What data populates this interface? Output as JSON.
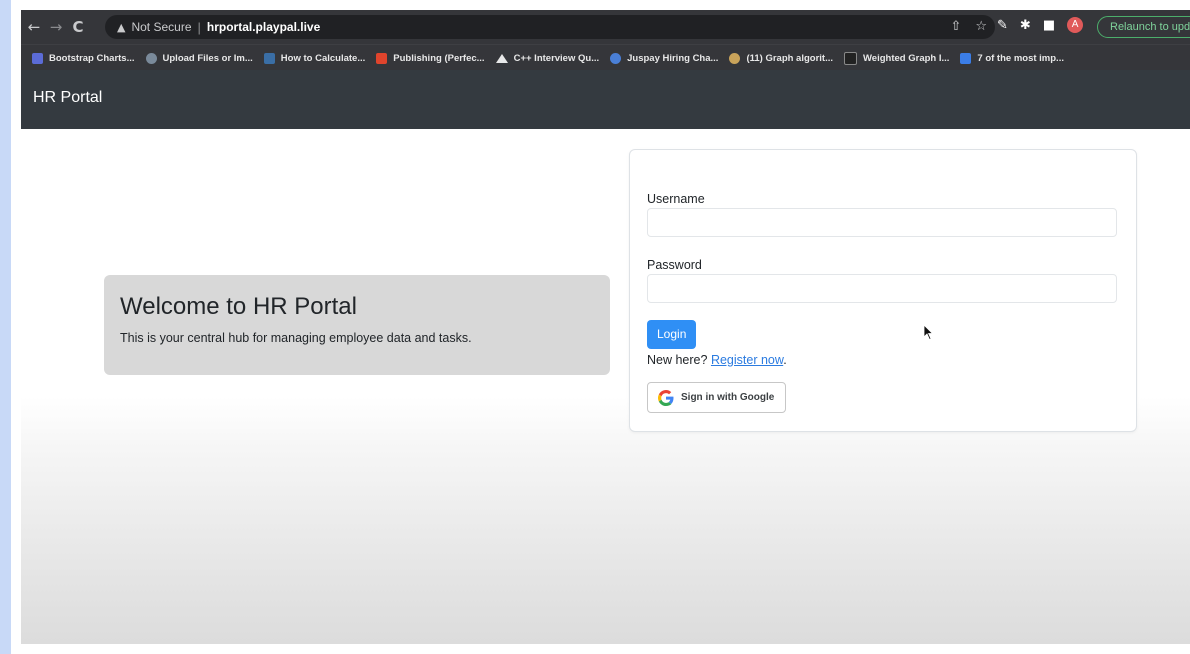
{
  "browser": {
    "nav": {
      "back": "←",
      "forward": "→",
      "reload": "C"
    },
    "security_label": "Not Secure",
    "separator": "|",
    "url": "hrportal.playpal.live",
    "avatar_letter": "A",
    "relaunch_label": "Relaunch to upda",
    "bookmarks": [
      {
        "label": "Bootstrap Charts...",
        "color": "#5b6bd6"
      },
      {
        "label": "Upload Files or Im...",
        "color": "#7a8a9a"
      },
      {
        "label": "How to Calculate...",
        "color": "#3a6ea5"
      },
      {
        "label": "Publishing (Perfec...",
        "color": "#e0442c"
      },
      {
        "label": "C++ Interview Qu...",
        "color": "#e8e8e8"
      },
      {
        "label": "Juspay Hiring Cha...",
        "color": "#4a7fd6"
      },
      {
        "label": "(11) Graph algorit...",
        "color": "#c9a35a"
      },
      {
        "label": "Weighted Graph I...",
        "color": "#222222"
      },
      {
        "label": "7 of the most imp...",
        "color": "#3b7de6"
      }
    ]
  },
  "navbar": {
    "brand": "HR Portal"
  },
  "hero": {
    "title": "Welcome to HR Portal",
    "subtitle": "This is your central hub for managing employee data and tasks."
  },
  "login": {
    "username_label": "Username",
    "username_value": "",
    "password_label": "Password",
    "password_value": "",
    "login_button": "Login",
    "register_prefix": "New here? ",
    "register_link": "Register now",
    "register_suffix": ".",
    "google_button": "Sign in with Google"
  },
  "colors": {
    "navbar_bg": "#343a40",
    "primary": "#2f8ff5",
    "link": "#2b7be0",
    "jumbotron_bg": "#d8d8d8"
  }
}
